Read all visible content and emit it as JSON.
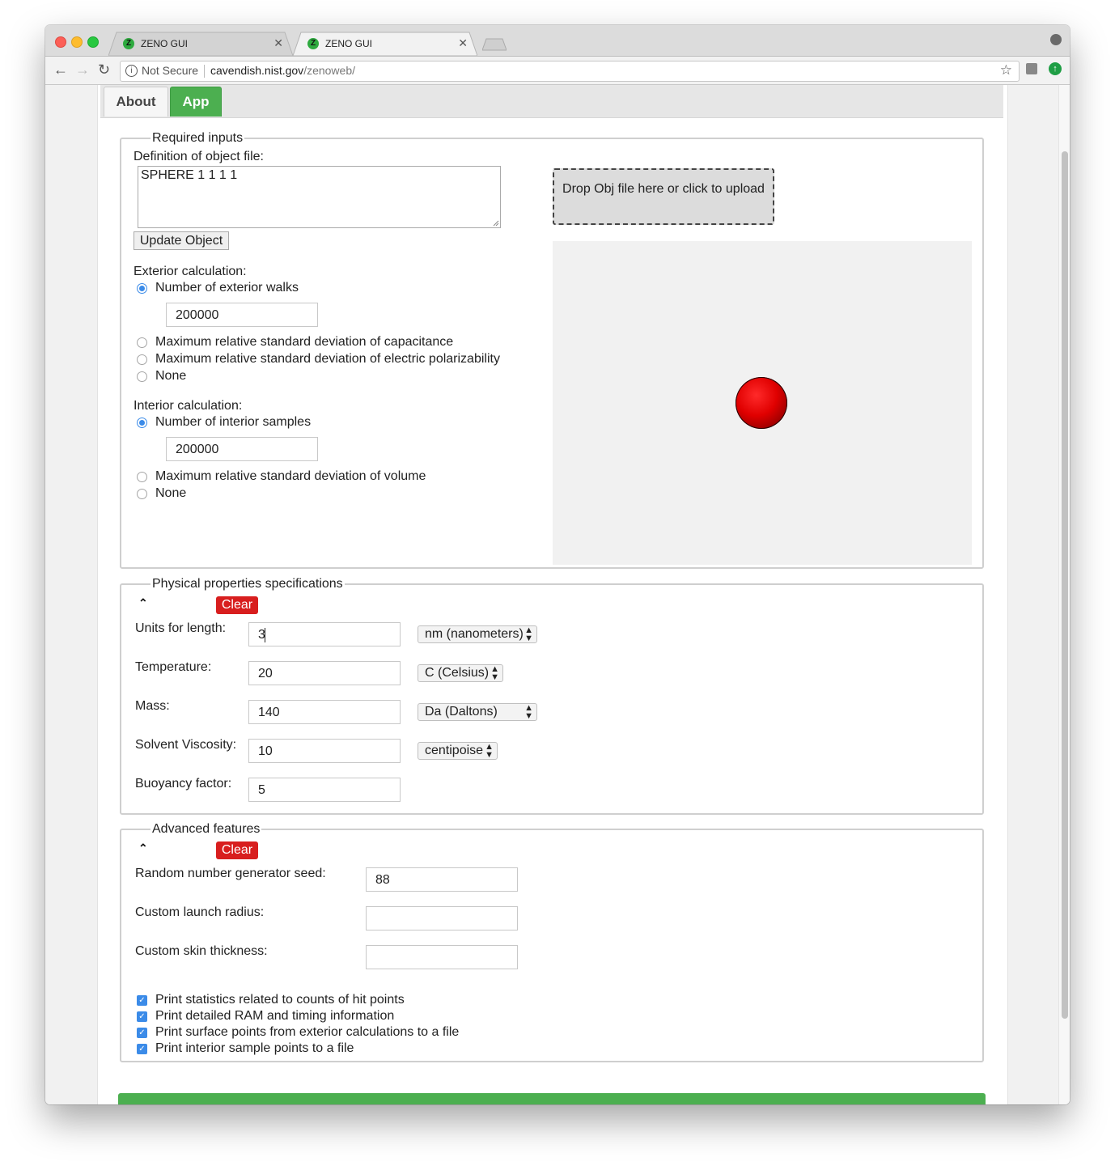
{
  "browser": {
    "tabs": [
      {
        "title": "ZENO GUI",
        "favicon": "Z"
      },
      {
        "title": "ZENO GUI",
        "favicon": "Z"
      }
    ],
    "address": {
      "security": "Not Secure",
      "host": "cavendish.nist.gov",
      "path": "/zenoweb/"
    }
  },
  "nav_tabs": {
    "about": "About",
    "app": "App"
  },
  "required": {
    "legend": "Required inputs",
    "object_label": "Definition of object file:",
    "object_text": "SPHERE 1 1 1 1",
    "update_button": "Update Object",
    "exterior_label": "Exterior calculation:",
    "exterior_options": [
      "Number of exterior walks",
      "Maximum relative standard deviation of capacitance",
      "Maximum relative standard deviation of electric polarizability",
      "None"
    ],
    "exterior_selected": 0,
    "exterior_walks": "200000",
    "interior_label": "Interior calculation:",
    "interior_options": [
      "Number of interior samples",
      "Maximum relative standard deviation of volume",
      "None"
    ],
    "interior_selected": 0,
    "interior_samples": "200000",
    "dropzone_text": "Drop Obj file here or click to upload"
  },
  "physical": {
    "legend": "Physical properties specifications",
    "clear": "Clear",
    "rows": [
      {
        "label": "Units for length:",
        "value": "3",
        "unit": "nm (nanometers)"
      },
      {
        "label": "Temperature:",
        "value": "20",
        "unit": "C (Celsius)"
      },
      {
        "label": "Mass:",
        "value": "140",
        "unit": "Da (Daltons)"
      },
      {
        "label": "Solvent Viscosity:",
        "value": "10",
        "unit": "centipoise"
      },
      {
        "label": "Buoyancy factor:",
        "value": "5",
        "unit": ""
      }
    ]
  },
  "advanced": {
    "legend": "Advanced features",
    "clear": "Clear",
    "rows": [
      {
        "label": "Random number generator seed:",
        "value": "88"
      },
      {
        "label": "Custom launch radius:",
        "value": ""
      },
      {
        "label": "Custom skin thickness:",
        "value": ""
      }
    ],
    "checks": [
      "Print statistics related to counts of hit points",
      "Print detailed RAM and timing information",
      "Print surface points from exterior calculations to a file",
      "Print interior sample points to a file"
    ]
  },
  "colors": {
    "accent_green": "#4caf50",
    "clear_red": "#d81e1e",
    "radio_blue": "#3b8be8",
    "sphere_red": "#e00000"
  }
}
